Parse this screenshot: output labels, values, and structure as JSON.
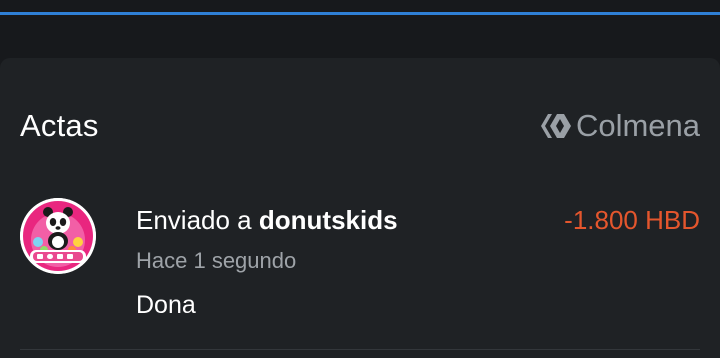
{
  "colors": {
    "background": "#17191c",
    "card": "#1f2225",
    "accent_line": "#2f80d6",
    "negative_amount": "#e4562d",
    "muted_text": "#9ea3a8"
  },
  "card": {
    "title": "Actas",
    "brand_label": "Colmena",
    "brand_icon": "hive-logo-icon"
  },
  "transactions": [
    {
      "avatar_icon": "donutskids-avatar",
      "action_prefix": "Enviado a",
      "counterparty": "donutskids",
      "amount": "-1.800 HBD",
      "time": "Hace 1 segundo",
      "memo": "Dona"
    }
  ]
}
